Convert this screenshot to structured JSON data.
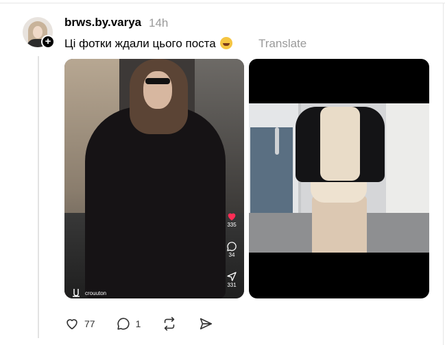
{
  "post": {
    "username": "brws.by.varya",
    "timestamp": "14h",
    "text": "Ці фотки ждали цього поста",
    "translate_label": "Translate",
    "media": [
      {
        "type": "video",
        "overlay": {
          "likes": "335",
          "comments": "34",
          "shares": "331",
          "author": "crouuton"
        }
      },
      {
        "type": "photo"
      }
    ],
    "actions": {
      "likes": "77",
      "replies": "1"
    }
  },
  "colors": {
    "heart_red": "#ff2d55",
    "muted_text": "#9a9a9a"
  },
  "icons": [
    "avatar",
    "follow-plus-icon",
    "heart-icon",
    "comment-icon",
    "share-icon",
    "repost-icon",
    "send-icon",
    "mute-icon"
  ]
}
